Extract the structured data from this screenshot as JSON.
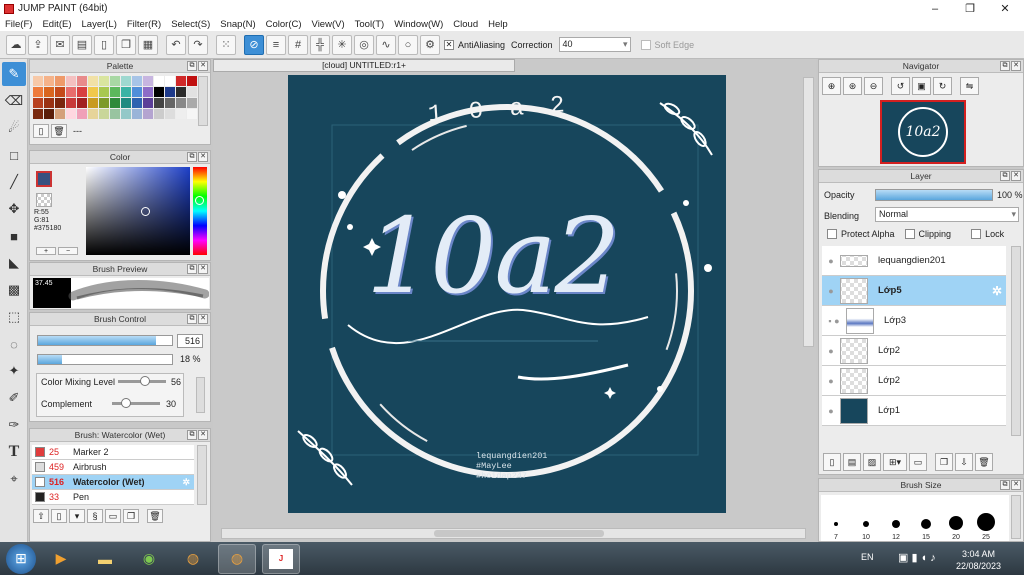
{
  "window": {
    "title": "JUMP PAINT (64bit)",
    "minimize": "–",
    "maximize": "❐",
    "close": "✕"
  },
  "menu": [
    "File(F)",
    "Edit(E)",
    "Layer(L)",
    "Filter(R)",
    "Select(S)",
    "Snap(N)",
    "Color(C)",
    "View(V)",
    "Tool(T)",
    "Window(W)",
    "Cloud",
    "Help"
  ],
  "toolbar": {
    "antialias_label": "AntiAliasing",
    "correction_label": "Correction",
    "correction_value": "40",
    "softedge_label": "Soft Edge"
  },
  "palette": {
    "title": "Palette",
    "footer": "---",
    "colors": [
      "#f7c9a8",
      "#f5b38a",
      "#ee9a6a",
      "#f4c0c0",
      "#e88b8b",
      "#f1e1a6",
      "#d9e59f",
      "#a8d8a4",
      "#9ed8d0",
      "#a7c4e7",
      "#c7b5e0",
      "#ffffff",
      "#ffffff",
      "#d02828",
      "#c01010",
      "#ee7b3c",
      "#d9661f",
      "#c44a1a",
      "#e86d6d",
      "#d74040",
      "#f0c84a",
      "#a8c850",
      "#5cb85c",
      "#3bb3a5",
      "#4f8ed9",
      "#8d6cc7",
      "#000000",
      "#1e3a8a",
      "#2b2b2b",
      "#e1e1e1",
      "#b8411f",
      "#9a3212",
      "#7a260d",
      "#c73a3a",
      "#a12020",
      "#c89b20",
      "#7c9a2a",
      "#2f8a3a",
      "#1f8a80",
      "#2d62b0",
      "#5c3f98",
      "#444444",
      "#666666",
      "#888888",
      "#aaaaaa",
      "#7a2a10",
      "#5a1e0a",
      "#d4a07a",
      "#ffd7e0",
      "#f0a0b8",
      "#e6d49a",
      "#c9d69a",
      "#98c4a0",
      "#94c8c8",
      "#9ab4d8",
      "#b4a4d0",
      "#cccccc",
      "#dddddd",
      "#eeeeee",
      "#f6f6f6"
    ]
  },
  "color": {
    "title": "Color",
    "r": "R:55",
    "g": "G:81",
    "hex": "#375180",
    "current": "#375180"
  },
  "brush_preview": {
    "title": "Brush Preview",
    "size_text": "37.45"
  },
  "brush_control": {
    "title": "Brush Control",
    "size_value": "516",
    "opacity_value": "18 %",
    "mixing_label": "Color Mixing Level",
    "mixing_value": "56",
    "complement_label": "Complement",
    "complement_value": "30",
    "size_fill": 0.88,
    "opacity_fill": 0.18,
    "mixing_fill": 0.56,
    "complement_fill": 0.3
  },
  "brush_list": {
    "title": "Brush: Watercolor (Wet)",
    "items": [
      {
        "num": "25",
        "name": "Marker 2",
        "color": "#e03c3c"
      },
      {
        "num": "459",
        "name": "Airbrush",
        "color": "#dddddd"
      },
      {
        "num": "516",
        "name": "Watercolor (Wet)",
        "color": "#ffffff"
      },
      {
        "num": "33",
        "name": "Pen",
        "color": "#222222"
      }
    ]
  },
  "canvas": {
    "tab_title": "[cloud] UNTITLED:r1+",
    "bg": "#17465c",
    "ring_text": "1 0 a 2",
    "main_text": "10a2",
    "credit1": "lequangdien201",
    "credit2": "#MayLee",
    "credit3": "#hoidap247"
  },
  "navigator": {
    "title": "Navigator",
    "thumb_text": "10a2"
  },
  "layer": {
    "title": "Layer",
    "opacity_label": "Opacity",
    "opacity_value": "100 %",
    "opacity_fill": 1.0,
    "blending_label": "Blending",
    "blending_value": "Normal",
    "protect_alpha": "Protect Alpha",
    "clipping": "Clipping",
    "lock": "Lock",
    "layers": [
      {
        "name": "lequangdien201"
      },
      {
        "name": "Lớp5"
      },
      {
        "name": "Lớp3"
      },
      {
        "name": "Lớp2"
      },
      {
        "name": "Lớp2"
      },
      {
        "name": "Lớp1"
      }
    ]
  },
  "brush_size": {
    "title": "Brush Size",
    "sizes": [
      "7",
      "10",
      "12",
      "15",
      "20",
      "25"
    ]
  },
  "taskbar": {
    "lang": "EN",
    "time": "3:04 AM",
    "date": "22/08/2023"
  }
}
